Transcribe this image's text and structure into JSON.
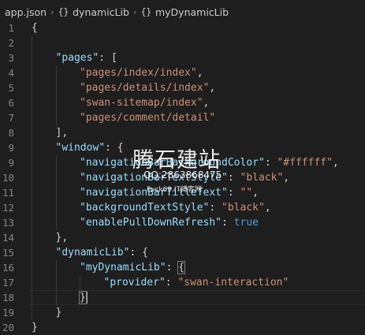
{
  "breadcrumb": {
    "file": "app.json",
    "items": [
      "dynamicLib",
      "myDynamicLib"
    ]
  },
  "editor": {
    "lines": [
      {
        "num": "1",
        "indent": 0,
        "tokens": [
          {
            "t": "p",
            "v": "{"
          }
        ]
      },
      {
        "num": "2",
        "indent": 1,
        "tokens": []
      },
      {
        "num": "3",
        "indent": 1,
        "tokens": [
          {
            "t": "k",
            "v": "\"pages\""
          },
          {
            "t": "p",
            "v": ": ["
          }
        ]
      },
      {
        "num": "4",
        "indent": 2,
        "tokens": [
          {
            "t": "s",
            "v": "\"pages/index/index\""
          },
          {
            "t": "p",
            "v": ","
          }
        ]
      },
      {
        "num": "5",
        "indent": 2,
        "tokens": [
          {
            "t": "s",
            "v": "\"pages/details/index\""
          },
          {
            "t": "p",
            "v": ","
          }
        ]
      },
      {
        "num": "6",
        "indent": 2,
        "tokens": [
          {
            "t": "s",
            "v": "\"swan-sitemap/index\""
          },
          {
            "t": "p",
            "v": ","
          }
        ]
      },
      {
        "num": "7",
        "indent": 2,
        "tokens": [
          {
            "t": "s",
            "v": "\"pages/comment/detail\""
          }
        ]
      },
      {
        "num": "8",
        "indent": 1,
        "tokens": [
          {
            "t": "p",
            "v": "],"
          }
        ]
      },
      {
        "num": "9",
        "indent": 1,
        "tokens": [
          {
            "t": "k",
            "v": "\"window\""
          },
          {
            "t": "p",
            "v": ": {"
          }
        ]
      },
      {
        "num": "9",
        "indent": 2,
        "tokens": [
          {
            "t": "k",
            "v": "\"navigationBarBackgroundColor\""
          },
          {
            "t": "p",
            "v": ": "
          },
          {
            "t": "s",
            "v": "\"#ffffff\""
          },
          {
            "t": "p",
            "v": ","
          }
        ]
      },
      {
        "num": "10",
        "indent": 2,
        "tokens": [
          {
            "t": "k",
            "v": "\"navigationBarTextStyle\""
          },
          {
            "t": "p",
            "v": ": "
          },
          {
            "t": "s",
            "v": "\"black\""
          },
          {
            "t": "p",
            "v": ","
          }
        ]
      },
      {
        "num": "11",
        "indent": 2,
        "tokens": [
          {
            "t": "k",
            "v": "\"navigationBarTitleText\""
          },
          {
            "t": "p",
            "v": ": "
          },
          {
            "t": "s",
            "v": "\"\""
          },
          {
            "t": "p",
            "v": ","
          }
        ]
      },
      {
        "num": "12",
        "indent": 2,
        "tokens": [
          {
            "t": "k",
            "v": "\"backgroundTextStyle\""
          },
          {
            "t": "p",
            "v": ": "
          },
          {
            "t": "s",
            "v": "\"black\""
          },
          {
            "t": "p",
            "v": ","
          }
        ]
      },
      {
        "num": "13",
        "indent": 2,
        "tokens": [
          {
            "t": "k",
            "v": "\"enablePullDownRefresh\""
          },
          {
            "t": "p",
            "v": ": "
          },
          {
            "t": "b",
            "v": "true"
          }
        ]
      },
      {
        "num": "14",
        "indent": 1,
        "tokens": [
          {
            "t": "p",
            "v": "},"
          }
        ]
      },
      {
        "num": "15",
        "indent": 1,
        "tokens": [
          {
            "t": "k",
            "v": "\"dynamicLib\""
          },
          {
            "t": "p",
            "v": ": {"
          }
        ]
      },
      {
        "num": "16",
        "indent": 2,
        "tokens": [
          {
            "t": "k",
            "v": "\"myDynamicLib\""
          },
          {
            "t": "p",
            "v": ": "
          },
          {
            "t": "p",
            "v": "{",
            "m": 1
          }
        ]
      },
      {
        "num": "17",
        "indent": 3,
        "tokens": [
          {
            "t": "k",
            "v": "\"provider\""
          },
          {
            "t": "p",
            "v": ": "
          },
          {
            "t": "s",
            "v": "\"swan-interaction\""
          }
        ]
      },
      {
        "num": "18",
        "indent": 2,
        "active": true,
        "tokens": [
          {
            "t": "p",
            "v": "}",
            "m": 1
          }
        ]
      },
      {
        "num": "19",
        "indent": 1,
        "tokens": [
          {
            "t": "p",
            "v": "}"
          }
        ]
      },
      {
        "num": "20",
        "indent": 0,
        "tokens": [
          {
            "t": "p",
            "v": "}"
          }
        ]
      }
    ]
  },
  "watermark": {
    "big": "腾石建站",
    "qq": "QQ:2863868475",
    "small": "Fuck69.IT博客网"
  }
}
